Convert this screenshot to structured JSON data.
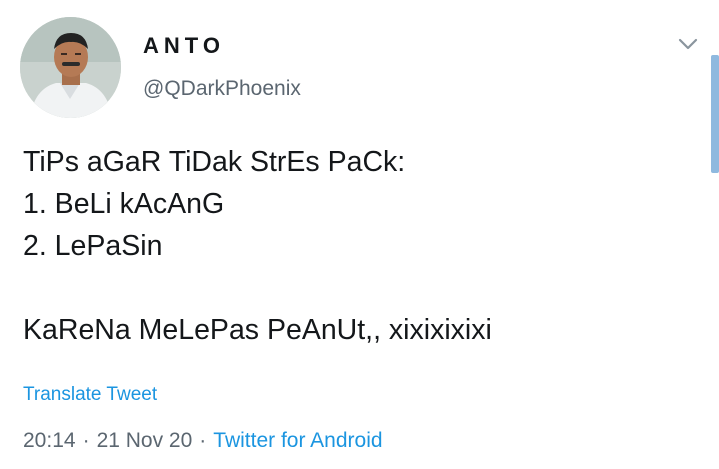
{
  "user": {
    "display_name": "ANTO",
    "handle": "@QDarkPhoenix"
  },
  "tweet": {
    "lines": [
      "TiPs aGaR TiDak StrEs PaCk:",
      "1. BeLi kAcAnG",
      "2. LePaSin",
      "",
      "KaReNa MeLePas PeAnUt,, xixixixixi"
    ],
    "translate_label": "Translate Tweet",
    "time": "20:14",
    "date": "21 Nov 20",
    "separator": "·",
    "source": "Twitter for Android"
  },
  "icons": {
    "menu": "chevron-down-icon",
    "avatar": "profile-photo"
  },
  "colors": {
    "link": "#1b95e0",
    "secondary_text": "#5b6670",
    "primary_text": "#14171a"
  }
}
